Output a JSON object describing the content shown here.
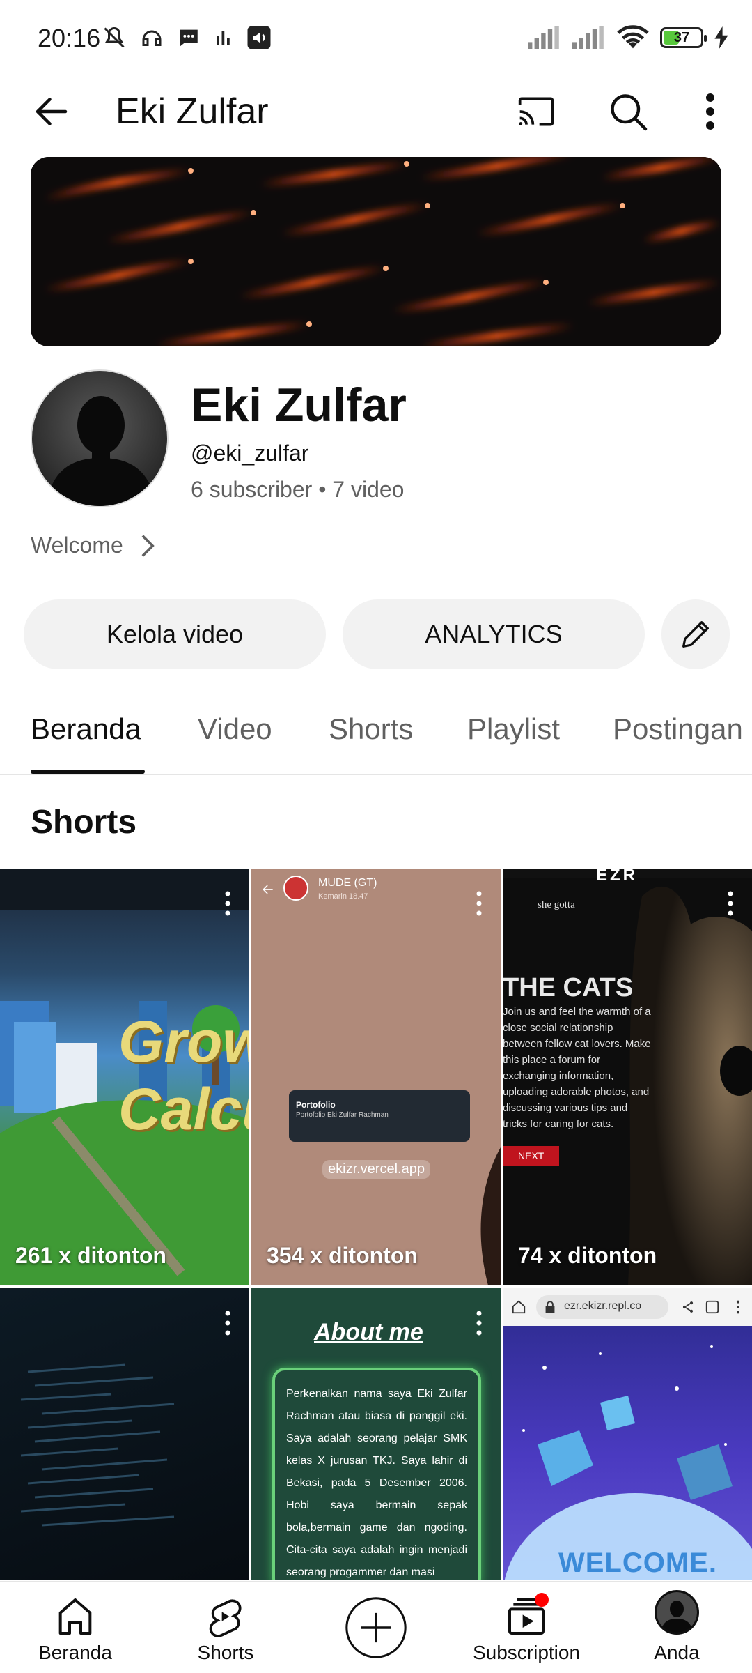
{
  "status_bar": {
    "time": "20:16",
    "battery": "37"
  },
  "app_bar": {
    "title": "Eki Zulfar"
  },
  "channel": {
    "name": "Eki Zulfar",
    "handle": "@eki_zulfar",
    "subscribers": "6 subscriber",
    "separator": "•",
    "videos": "7 video",
    "description": "Welcome"
  },
  "actions": {
    "manage_videos": "Kelola video",
    "analytics": "ANALYTICS"
  },
  "tabs": [
    {
      "label": "Beranda",
      "active": true
    },
    {
      "label": "Video"
    },
    {
      "label": "Shorts"
    },
    {
      "label": "Playlist"
    },
    {
      "label": "Postingan"
    }
  ],
  "section": {
    "title": "Shorts"
  },
  "shorts": [
    {
      "views": "261 x ditonton",
      "overlay_text": "Growtopia Calculator"
    },
    {
      "views": "354 x ditonton",
      "overlay_user": "MUDE (GT)",
      "overlay_time": "Kemarin 18.47",
      "overlay_card_title": "Portofolio",
      "overlay_card_sub": "Portofolio Eki Zulfar Rachman",
      "overlay_url": "ekizr.vercel.app"
    },
    {
      "views": "74 x ditonton",
      "overlay_brand": "EZR",
      "overlay_small": "she gotta",
      "overlay_heading": "THE CATS",
      "overlay_body": "Join us and feel the warmth of a close social relationship between fellow cat lovers. Make this place a forum for exchanging information, uploading adorable photos, and discussing various tips and tricks for caring for cats.",
      "overlay_button": "NEXT"
    },
    {
      "views": ""
    },
    {
      "views": "",
      "overlay_heading": "About me",
      "overlay_body": "Perkenalkan nama saya Eki Zulfar Rachman atau biasa di panggil eki. Saya adalah seorang pelajar SMK kelas X jurusan TKJ. Saya lahir di Bekasi, pada 5 Desember 2006. Hobi saya bermain sepak bola,bermain game dan ngoding. Cita-cita saya adalah ingin menjadi seorang progammer dan masi"
    },
    {
      "views": "",
      "overlay_url": "ezr.ekizr.repl.co",
      "overlay_heading": "WELCOME."
    }
  ],
  "bottom_nav": [
    {
      "label": "Beranda",
      "icon": "home-icon"
    },
    {
      "label": "Shorts",
      "icon": "shorts-icon"
    },
    {
      "label": "",
      "icon": "create-icon"
    },
    {
      "label": "Subscription",
      "icon": "subscriptions-icon"
    },
    {
      "label": "Anda",
      "icon": "avatar"
    }
  ],
  "colors": {
    "accent": "#0f0f0f",
    "muted": "#606060",
    "chip_bg": "#f2f2f2",
    "badge": "#ff0000",
    "battery": "#58c83c"
  }
}
